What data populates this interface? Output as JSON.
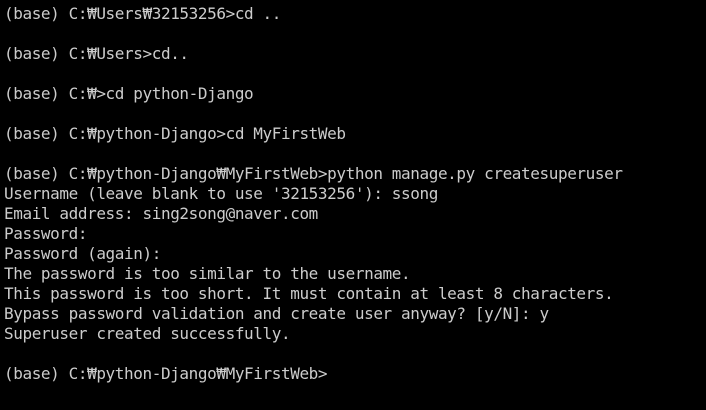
{
  "terminal": {
    "lines": [
      "(base) C:₩Users₩32153256>cd ..",
      "",
      "(base) C:₩Users>cd..",
      "",
      "(base) C:₩>cd python-Django",
      "",
      "(base) C:₩python-Django>cd MyFirstWeb",
      "",
      "(base) C:₩python-Django₩MyFirstWeb>python manage.py createsuperuser",
      "Username (leave blank to use '32153256'): ssong",
      "Email address: sing2song@naver.com",
      "Password:",
      "Password (again):",
      "The password is too similar to the username.",
      "This password is too short. It must contain at least 8 characters.",
      "Bypass password validation and create user anyway? [y/N]: y",
      "Superuser created successfully.",
      "",
      "(base) C:₩python-Django₩MyFirstWeb>"
    ]
  }
}
